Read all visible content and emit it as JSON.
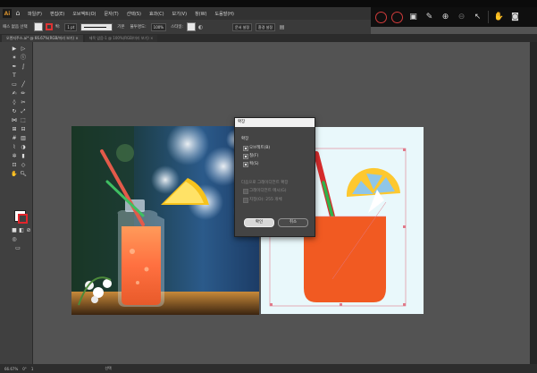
{
  "menubar": {
    "app_logo": "Ai",
    "items": [
      "파일(F)",
      "편집(E)",
      "오브젝트(O)",
      "문자(T)",
      "선택(S)",
      "효과(C)",
      "보기(V)",
      "창(W)",
      "도움말(H)"
    ]
  },
  "controlbar": {
    "selection_label": "패스 없음 선택",
    "stroke_label": "획:",
    "stroke_weight": "1 pt",
    "brush_label": "기본",
    "opacity_label": "불투명도:",
    "opacity_value": "100%",
    "style_label": "스타일:",
    "doc_setup": "문서 설정",
    "preferences": "환경 설정"
  },
  "tabs": [
    {
      "label": "오렌지주스.ai* @ 66.67%(RGB/미리 보기)"
    },
    {
      "label": "제목 없음-1 @ 100%(RGB/미리 보기)"
    }
  ],
  "dialog": {
    "title": "확장",
    "section": "확장",
    "options": [
      {
        "label": "오브젝트(B)",
        "checked": true
      },
      {
        "label": "칠(F)",
        "checked": true
      },
      {
        "label": "획(S)",
        "checked": true
      }
    ],
    "gradient_section": "다음으로 그레이디언트 확장",
    "gradient_options": [
      {
        "label": "그레이디언트 메시(G)"
      },
      {
        "label": "지정(O): 255 개체"
      }
    ],
    "ok_label": "확인",
    "cancel_label": "취소"
  },
  "statusbar": {
    "zoom": "66.67%",
    "rotation": "0°",
    "page": "1",
    "tool": "선택"
  },
  "colors": {
    "juice_orange": "#f15a22",
    "lemon_yellow": "#fdc82f",
    "lemon_blue": "#8fc6e8",
    "straw_red": "#d62c2c",
    "straw_green": "#2fb34a",
    "artboard_bg": "#e9f8fb"
  }
}
